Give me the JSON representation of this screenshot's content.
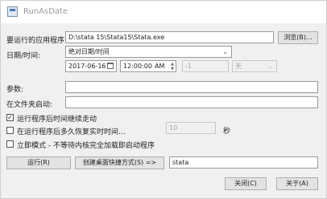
{
  "window": {
    "title": "RunAsDate"
  },
  "fields": {
    "app_label": "要运行的应用程序:",
    "app_path": "D:\\stata 15\\Stata15\\Stata.exe",
    "browse_label": "浏览(B)...",
    "datetime_label": "日期/时间:",
    "datetime_mode": "绝对日期/时间",
    "date_value": "2017-06-16",
    "time_value": "12:00:00",
    "time_suffix": "AM",
    "offset_value": "-1",
    "offset_unit": "天",
    "params_label": "参数:",
    "params_value": "",
    "startdir_label": "在文件夹启动:",
    "startdir_value": ""
  },
  "options": {
    "continue_label": "运行程序后时间继续走动",
    "continue_checked": true,
    "restore_label": "在运行程序后多久恢复实时时间...",
    "restore_checked": false,
    "restore_value": "10",
    "restore_unit": "秒",
    "immediate_label": "立即模式 - 不等待内核完全加载即启动程序",
    "immediate_checked": false
  },
  "actions": {
    "run_label": "运行(R)",
    "shortcut_label": "创建桌面快捷方式(S) =>",
    "shortcut_name": "stata",
    "close_label": "关闭(C)",
    "about_label": "关于(A)"
  }
}
